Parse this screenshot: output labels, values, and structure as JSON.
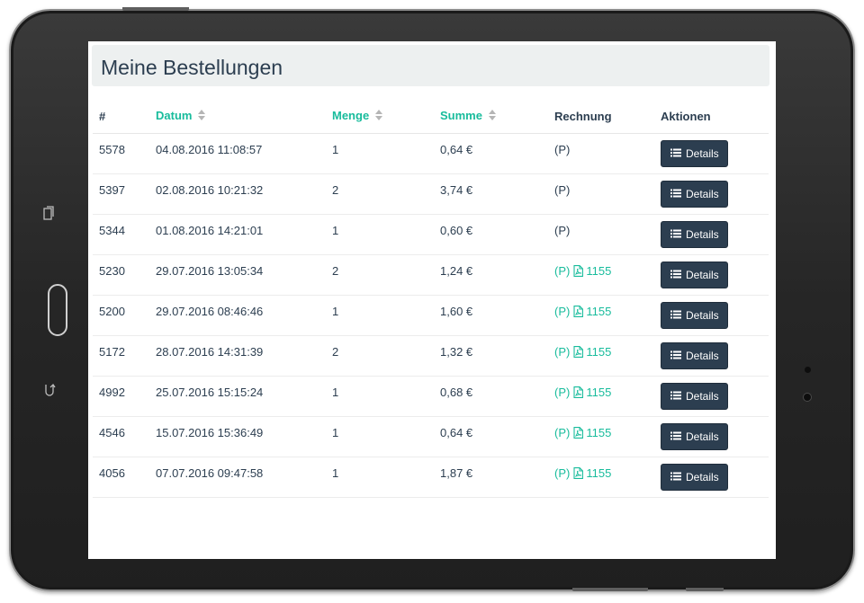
{
  "page": {
    "title": "Meine Bestellungen"
  },
  "table": {
    "columns": {
      "id": "#",
      "date": "Datum",
      "quantity": "Menge",
      "sum": "Summe",
      "invoice": "Rechnung",
      "actions": "Aktionen"
    },
    "rows": [
      {
        "id": "5578",
        "date": "04.08.2016 11:08:57",
        "quantity": "1",
        "sum": "0,64 €",
        "invoice_prefix": "(P)",
        "invoice_number": "",
        "details": "Details"
      },
      {
        "id": "5397",
        "date": "02.08.2016 10:21:32",
        "quantity": "2",
        "sum": "3,74 €",
        "invoice_prefix": "(P)",
        "invoice_number": "",
        "details": "Details"
      },
      {
        "id": "5344",
        "date": "01.08.2016 14:21:01",
        "quantity": "1",
        "sum": "0,60 €",
        "invoice_prefix": "(P)",
        "invoice_number": "",
        "details": "Details"
      },
      {
        "id": "5230",
        "date": "29.07.2016 13:05:34",
        "quantity": "2",
        "sum": "1,24 €",
        "invoice_prefix": "(P)",
        "invoice_number": "1155",
        "details": "Details"
      },
      {
        "id": "5200",
        "date": "29.07.2016 08:46:46",
        "quantity": "1",
        "sum": "1,60 €",
        "invoice_prefix": "(P)",
        "invoice_number": "1155",
        "details": "Details"
      },
      {
        "id": "5172",
        "date": "28.07.2016 14:31:39",
        "quantity": "2",
        "sum": "1,32 €",
        "invoice_prefix": "(P)",
        "invoice_number": "1155",
        "details": "Details"
      },
      {
        "id": "4992",
        "date": "25.07.2016 15:15:24",
        "quantity": "1",
        "sum": "0,68 €",
        "invoice_prefix": "(P)",
        "invoice_number": "1155",
        "details": "Details"
      },
      {
        "id": "4546",
        "date": "15.07.2016 15:36:49",
        "quantity": "1",
        "sum": "0,64 €",
        "invoice_prefix": "(P)",
        "invoice_number": "1155",
        "details": "Details"
      },
      {
        "id": "4056",
        "date": "07.07.2016 09:47:58",
        "quantity": "1",
        "sum": "1,87 €",
        "invoice_prefix": "(P)",
        "invoice_number": "1155",
        "details": "Details"
      }
    ]
  },
  "icons": {
    "sort": "sort-icon",
    "pdf": "file-pdf-icon",
    "details": "list-icon"
  },
  "colors": {
    "primary": "#2c3e50",
    "accent": "#18bc9c",
    "header_bg": "#edf0f0",
    "device_frame": "#262626"
  }
}
